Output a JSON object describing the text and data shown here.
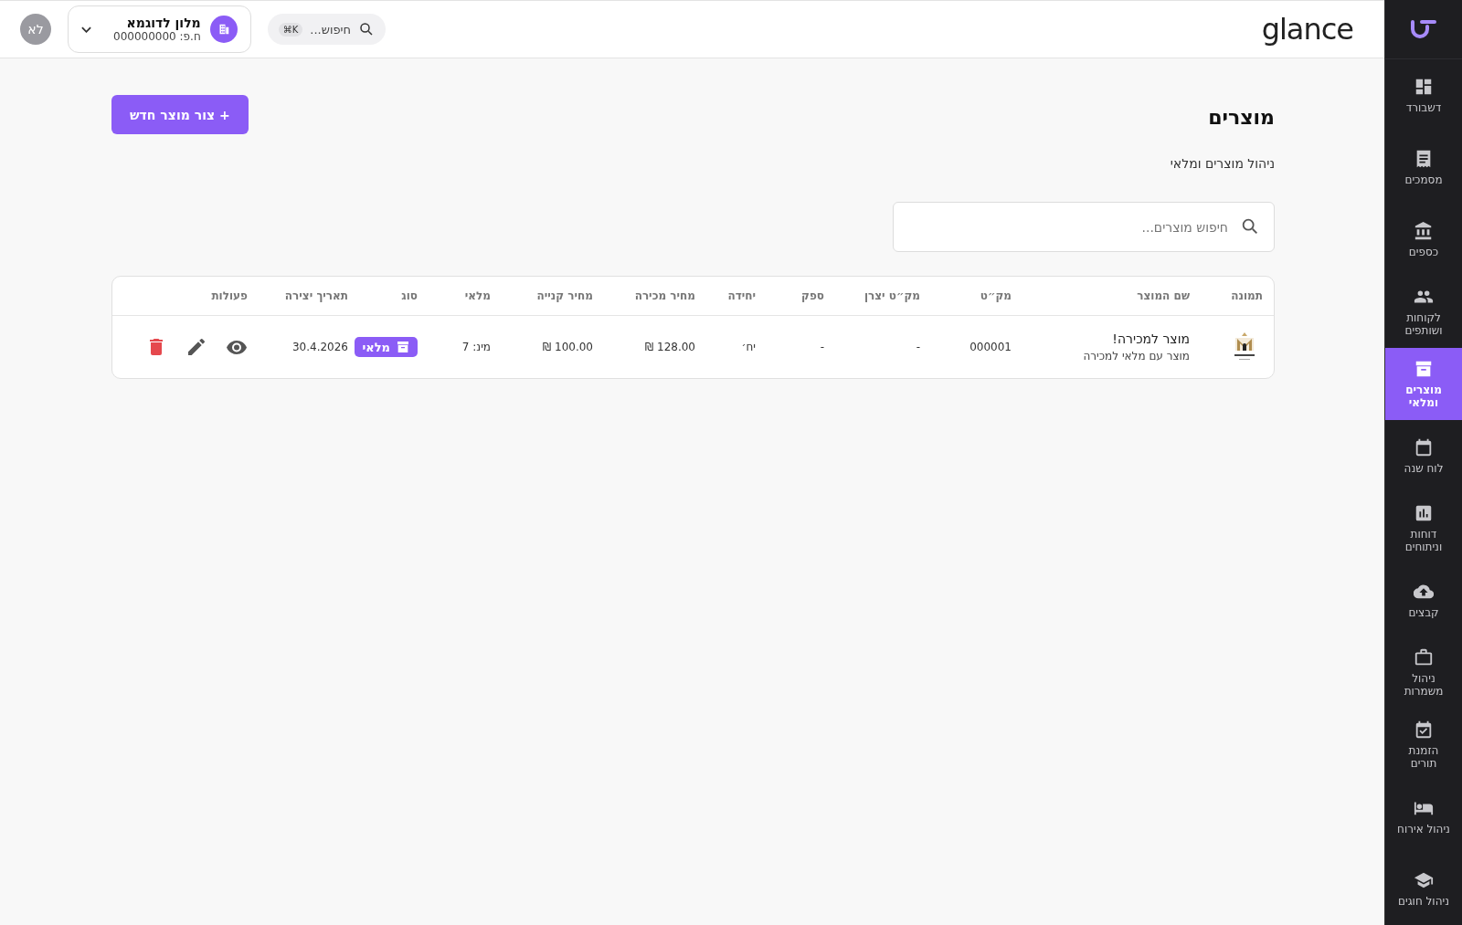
{
  "sidebar": {
    "items": [
      {
        "label": "דשבורד",
        "selected": false
      },
      {
        "label": "מסמכים",
        "selected": false
      },
      {
        "label": "כספים",
        "selected": false
      },
      {
        "label": "לקוחות ושותפים",
        "selected": false
      },
      {
        "label": "מוצרים ומלאי",
        "selected": true
      },
      {
        "label": "לוח שנה",
        "selected": false
      },
      {
        "label": "דוחות וניתוחים",
        "selected": false
      },
      {
        "label": "קבצים",
        "selected": false
      },
      {
        "label": "ניהול משמרות",
        "selected": false
      },
      {
        "label": "הזמנת תורים",
        "selected": false
      },
      {
        "label": "ניהול אירוח",
        "selected": false
      },
      {
        "label": "ניהול חוגים",
        "selected": false
      }
    ]
  },
  "header": {
    "logo": "glance",
    "search": {
      "placeholder": "חיפוש...",
      "shortcut": "⌘K"
    },
    "business": {
      "name": "מלון לדוגמא",
      "id_line": "ח.פ: 000000000"
    },
    "avatar": "לא"
  },
  "page": {
    "title": "מוצרים",
    "subtitle": "ניהול מוצרים ומלאי",
    "new_button": "+ צור מוצר חדש",
    "search": {
      "placeholder": "חיפוש מוצרים..."
    }
  },
  "table": {
    "columns": [
      "תמונה",
      "שם המוצר",
      "מק״ט",
      "מק״ט יצרן",
      "ספק",
      "יחידה",
      "מחיר מכירה",
      "מחיר קנייה",
      "מלאי",
      "סוג",
      "תאריך יצירה",
      "פעולות"
    ],
    "rows": [
      {
        "name": "מוצר למכירה!",
        "description": "מוצר עם מלאי למכירה",
        "sku": "000001",
        "manufacturer_sku": "-",
        "supplier": "-",
        "unit": "יח׳",
        "sale_price": "128.00 ₪",
        "purchase_price": "100.00 ₪",
        "stock": "מינ: 7",
        "type": "מלאי",
        "created": "30.4.2026"
      }
    ]
  }
}
